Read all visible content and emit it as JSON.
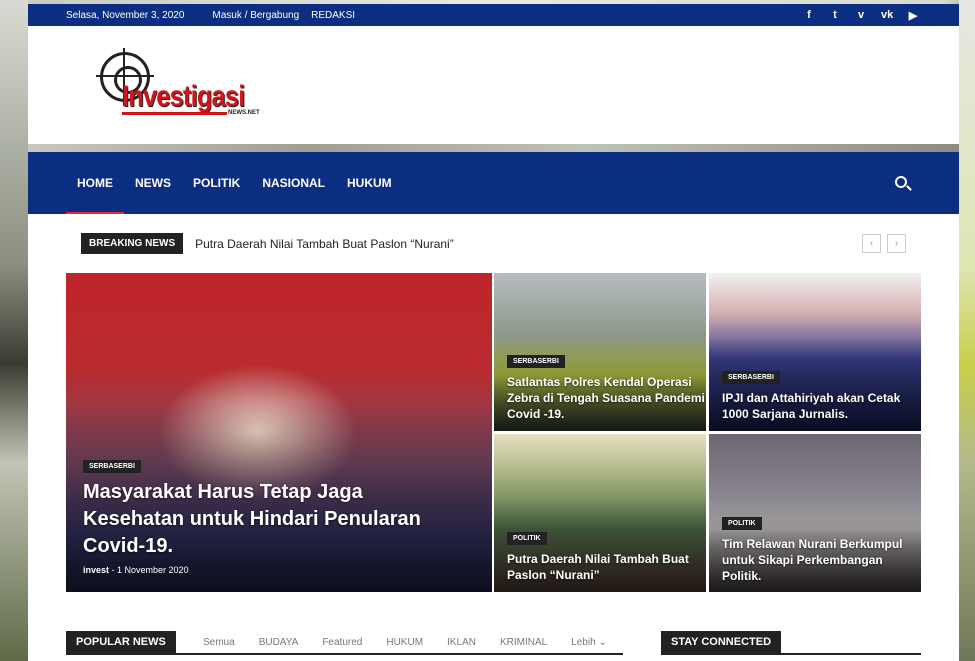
{
  "topbar": {
    "date": "Selasa, November 3, 2020",
    "login": "Masuk / Bergabung",
    "redaksi": "REDAKSI",
    "socials": [
      "facebook-icon",
      "twitter-icon",
      "vimeo-icon",
      "vk-icon",
      "youtube-icon"
    ],
    "social_glyphs": [
      "f",
      "t",
      "v",
      "vk",
      "▶"
    ]
  },
  "logo": {
    "text": "Investigasi",
    "sub": "NEWS.NET"
  },
  "nav": {
    "items": [
      "HOME",
      "NEWS",
      "POLITIK",
      "NASIONAL",
      "HUKUM"
    ],
    "active": "HOME"
  },
  "breaking": {
    "tag": "BREAKING NEWS",
    "title": "Putra Daerah Nilai Tambah Buat Paslon “Nurani”",
    "prev": "‹",
    "next": "›"
  },
  "featured": {
    "main": {
      "category": "SERBASERBI",
      "title": "Masyarakat Harus Tetap Jaga Kesehatan untuk Hindari Penularan Covid-19.",
      "author": "invest",
      "separator": " - ",
      "date": "1 November 2020"
    },
    "a": {
      "category": "SERBASERBI",
      "title": "Satlantas Polres Kendal Operasi Zebra di Tengah Suasana Pandemi Covid -19."
    },
    "b": {
      "category": "SERBASERBI",
      "title": "IPJI dan Attahiriyah akan Cetak 1000 Sarjana Jurnalis."
    },
    "c": {
      "category": "POLITIK",
      "title": "Putra Daerah Nilai Tambah Buat Paslon “Nurani”"
    },
    "d": {
      "category": "POLITIK",
      "title": "Tim Relawan Nurani Berkumpul untuk Sikapi Perkembangan Politik."
    }
  },
  "popular": {
    "heading": "POPULAR NEWS",
    "tabs": [
      "Semua",
      "BUDAYA",
      "Featured",
      "HUKUM",
      "IKLAN",
      "KRIMINAL",
      "Lebih ⌄"
    ]
  },
  "stay_connected": {
    "heading": "STAY CONNECTED"
  },
  "colors": {
    "brand_blue": "#0b2e82",
    "accent_red": "#e52a2f",
    "logo_red": "#d0141a"
  }
}
